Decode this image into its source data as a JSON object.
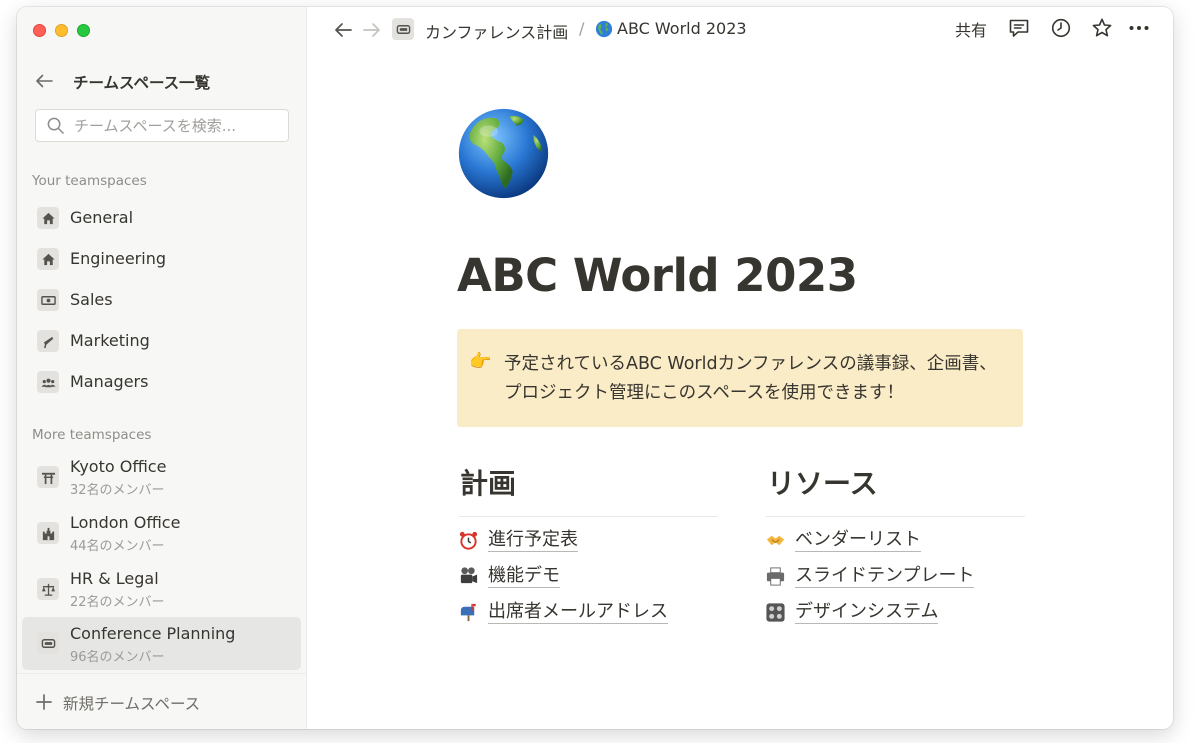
{
  "sidebar": {
    "header_title": "チームスペース一覧",
    "search_placeholder": "チームスペースを検索...",
    "your_label": "Your teamspaces",
    "your_items": [
      {
        "label": "General",
        "icon": "home-icon"
      },
      {
        "label": "Engineering",
        "icon": "home-icon"
      },
      {
        "label": "Sales",
        "icon": "money-icon"
      },
      {
        "label": "Marketing",
        "icon": "megaphone-icon"
      },
      {
        "label": "Managers",
        "icon": "people-icon"
      }
    ],
    "more_label": "More teamspaces",
    "more_items": [
      {
        "label": "Kyoto Office",
        "members": "32名のメンバー",
        "icon": "torii-icon"
      },
      {
        "label": "London Office",
        "members": "44名のメンバー",
        "icon": "castle-icon"
      },
      {
        "label": "HR & Legal",
        "members": "22名のメンバー",
        "icon": "scales-icon"
      },
      {
        "label": "Conference Planning",
        "members": "96名のメンバー",
        "icon": "projector-icon",
        "selected": true
      }
    ],
    "new_teamspace": "新規チームスペース"
  },
  "topbar": {
    "breadcrumb_parent": "カンファレンス計画",
    "breadcrumb_sep": "/",
    "breadcrumb_current": "ABC World 2023",
    "share_label": "共有"
  },
  "page": {
    "icon": "globe-americas-icon",
    "title": "ABC World 2023",
    "callout_icon": "👉",
    "callout_text": "予定されているABC Worldカンファレンスの議事録、企画書、プロジェクト管理にこのスペースを使用できます！",
    "columns": [
      {
        "heading": "計画",
        "links": [
          {
            "icon": "alarm-clock-icon",
            "text": "進行予定表"
          },
          {
            "icon": "movie-camera-icon",
            "text": "機能デモ"
          },
          {
            "icon": "mailbox-icon",
            "text": "出席者メールアドレス"
          }
        ]
      },
      {
        "heading": "リソース",
        "links": [
          {
            "icon": "handshake-icon",
            "text": "ベンダーリスト"
          },
          {
            "icon": "printer-icon",
            "text": "スライドテンプレート"
          },
          {
            "icon": "control-knobs-icon",
            "text": "デザインシステム"
          }
        ]
      }
    ]
  },
  "colors": {
    "sidebar_bg": "#f7f7f5",
    "callout_bg": "#fbecc8",
    "text": "#37352f",
    "muted": "#8f8d89"
  }
}
